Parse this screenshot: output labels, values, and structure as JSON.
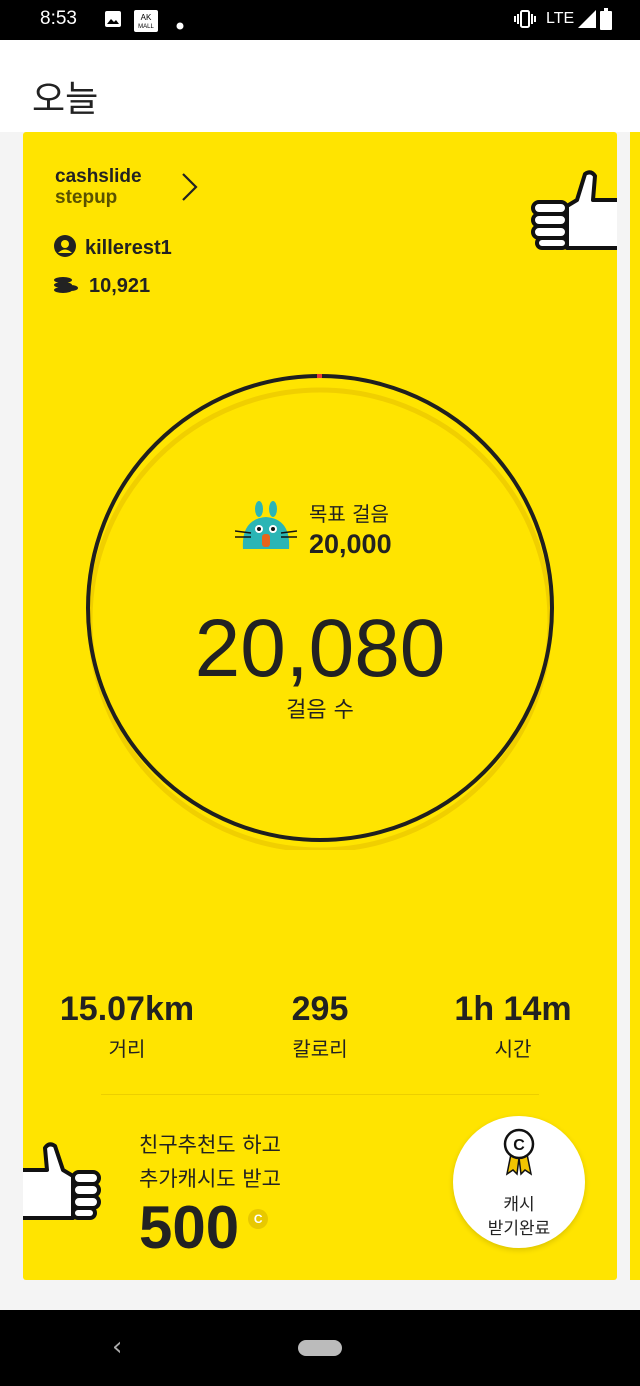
{
  "status_bar": {
    "time": "8:53",
    "network": "LTE",
    "icons": [
      "image-icon",
      "mall-app-icon",
      "notification-dot-icon",
      "vibrate-icon",
      "signal-icon",
      "battery-icon"
    ]
  },
  "header": {
    "title": "오늘"
  },
  "card": {
    "brand_line1": "cashslide",
    "brand_line2": "stepup",
    "username": "killerest1",
    "coins": "10,921",
    "goal_label": "목표 걸음",
    "goal_value": "20,000",
    "steps": "20,080",
    "steps_label": "걸음 수",
    "progress_fraction": 1.0,
    "stats": [
      {
        "value": "15.07km",
        "label": "거리"
      },
      {
        "value": "295",
        "label": "칼로리"
      },
      {
        "value": "1h 14m",
        "label": "시간"
      }
    ],
    "promo_line1": "친구추천도 하고",
    "promo_line2": "추가캐시도 받고",
    "promo_amount": "500",
    "promo_currency": "C",
    "cash_button_line1": "캐시",
    "cash_button_line2": "받기완료"
  },
  "nav": {
    "back": "‹"
  },
  "colors": {
    "card": "#ffe400",
    "ring": "#1f1f1f",
    "marker": "#e53935",
    "mascot": "#2bb5b5"
  }
}
